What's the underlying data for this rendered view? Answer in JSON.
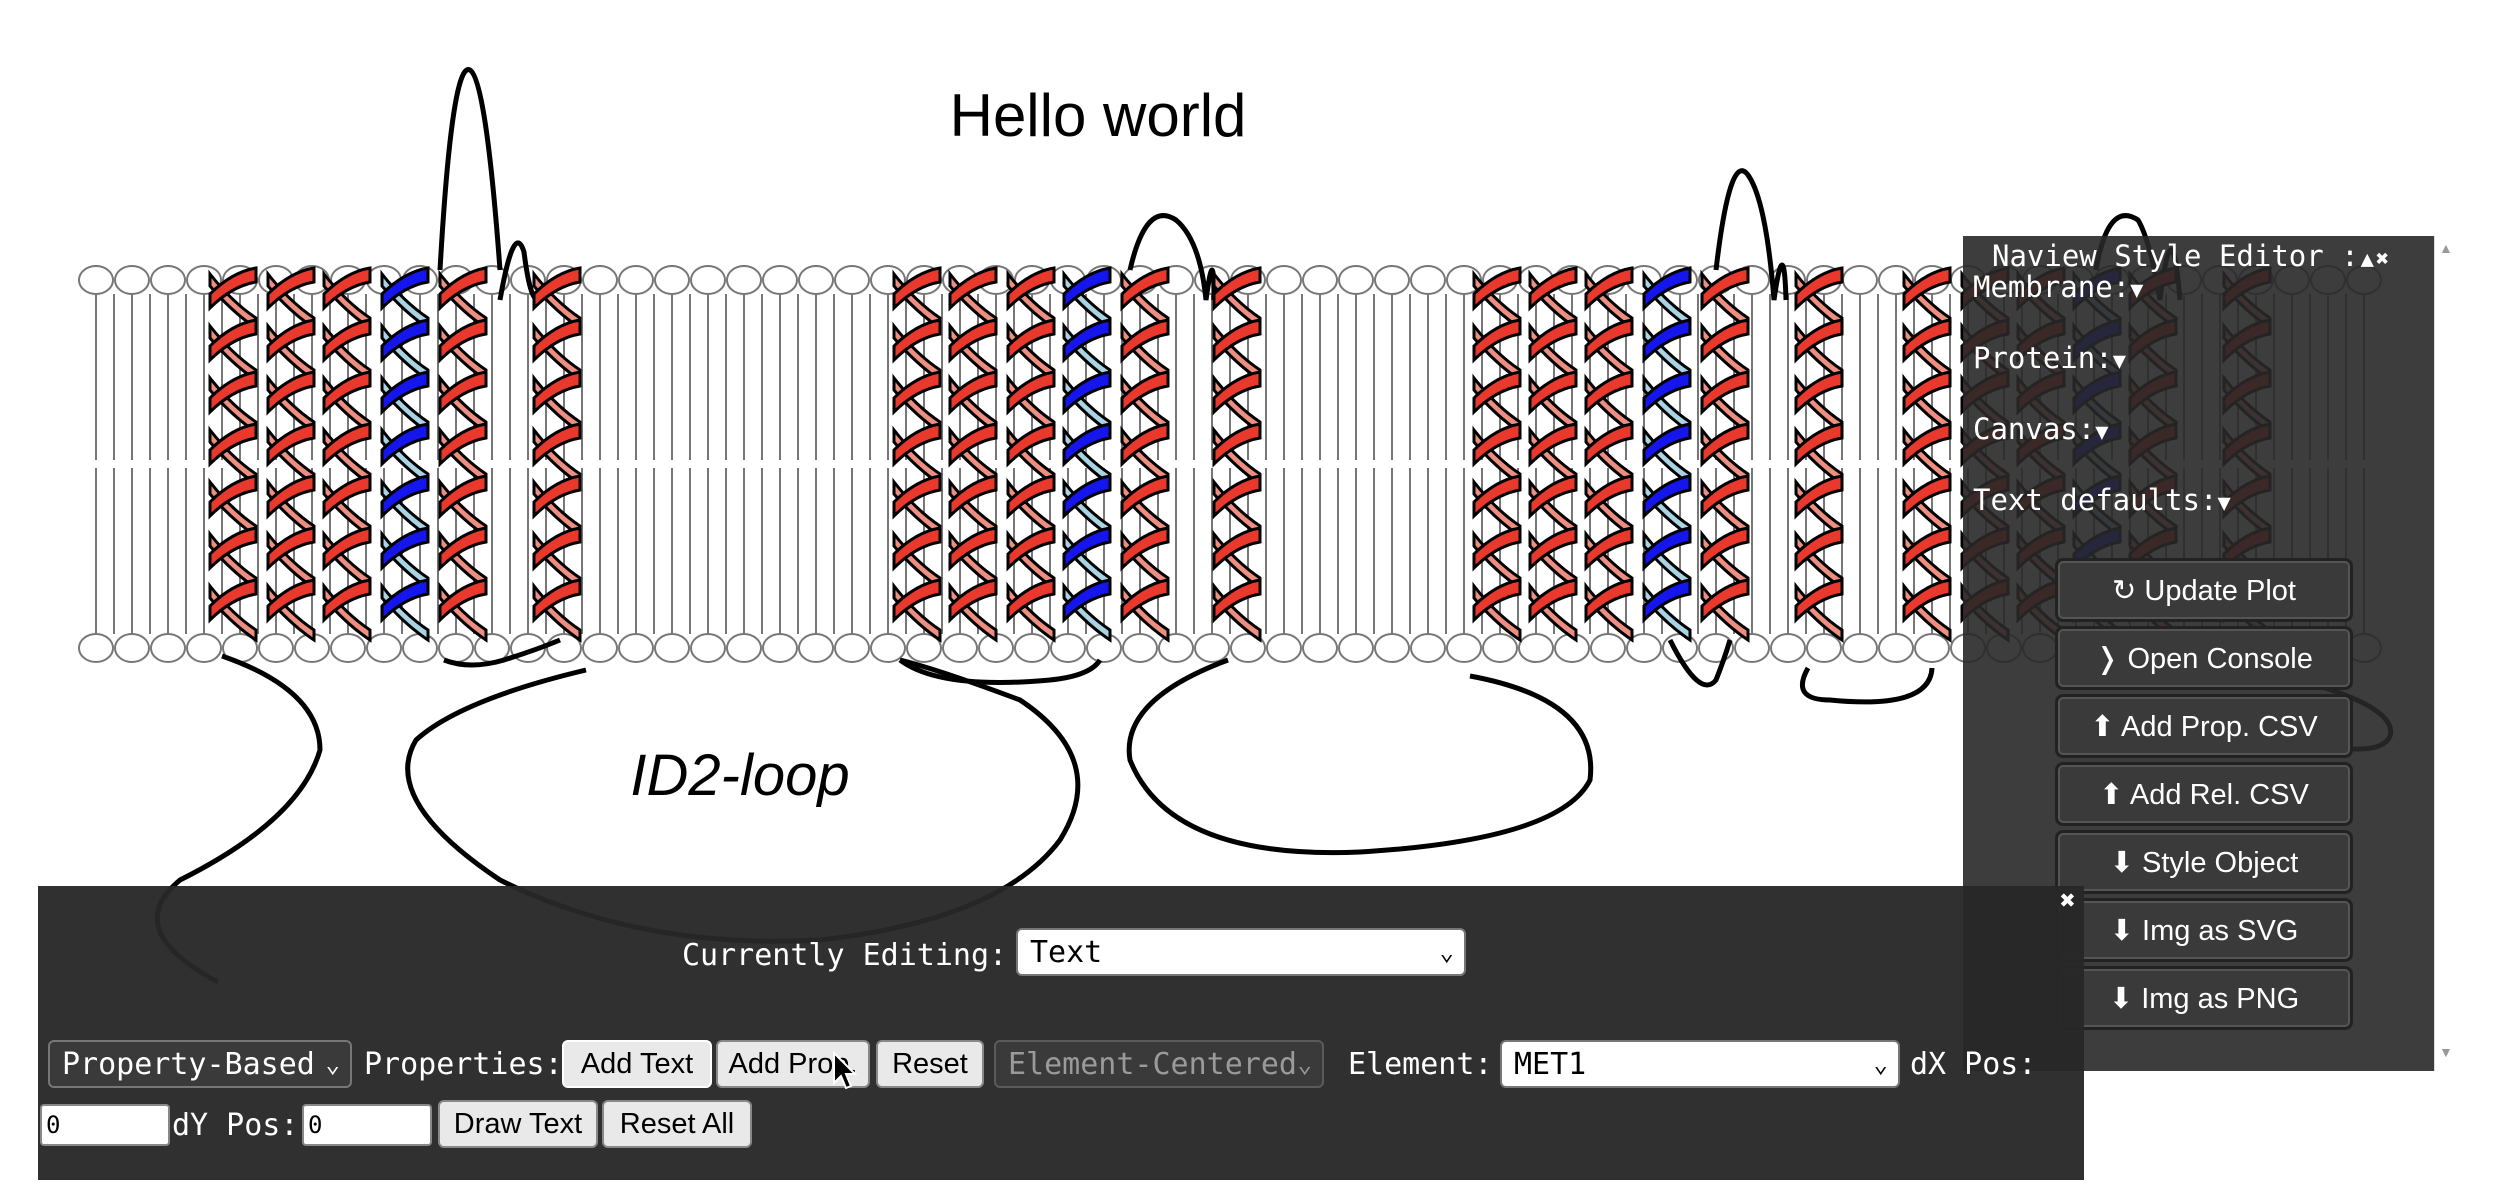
{
  "plot": {
    "title": "Hello world",
    "loop_label": "ID2-loop"
  },
  "colors": {
    "helix_red": "#e8392c",
    "helix_salmon": "#ee8e80",
    "helix_blue": "#1515ee",
    "helix_lightblue": "#a8d4e4",
    "panel_bg": "#2d2d2d"
  },
  "style_editor": {
    "title": "Naview Style Editor :",
    "collapse_icon": "▲",
    "close_icon": "✖",
    "sections": [
      {
        "label": "Membrane:",
        "arrow": "▼"
      },
      {
        "label": "Protein:",
        "arrow": "▼"
      },
      {
        "label": "Canvas:",
        "arrow": "▼"
      },
      {
        "label": "Text defaults:",
        "arrow": "▼"
      }
    ],
    "buttons": [
      "↻ Update Plot",
      "❭ Open Console",
      "⬆ Add Prop. CSV",
      "⬆ Add Rel. CSV",
      "⬇ Style Object",
      "⬇ Img as SVG",
      "⬇ Img as PNG"
    ]
  },
  "text_editor": {
    "close_icon": "✖",
    "currently_editing_label": "Currently Editing:",
    "currently_editing_value": "Text",
    "mode_select": "Property-Based",
    "properties_label": "Properties:",
    "add_text": "Add Text",
    "add_prop": "Add Prop.",
    "reset": "Reset",
    "anchor_select": "Element-Centered",
    "element_label": "Element:",
    "element_value": "MET1",
    "dx_label": "dX Pos:",
    "dx_value": "0",
    "dy_label": "dY Pos:",
    "dy_value": "0",
    "draw_text": "Draw Text",
    "reset_all": "Reset All"
  }
}
